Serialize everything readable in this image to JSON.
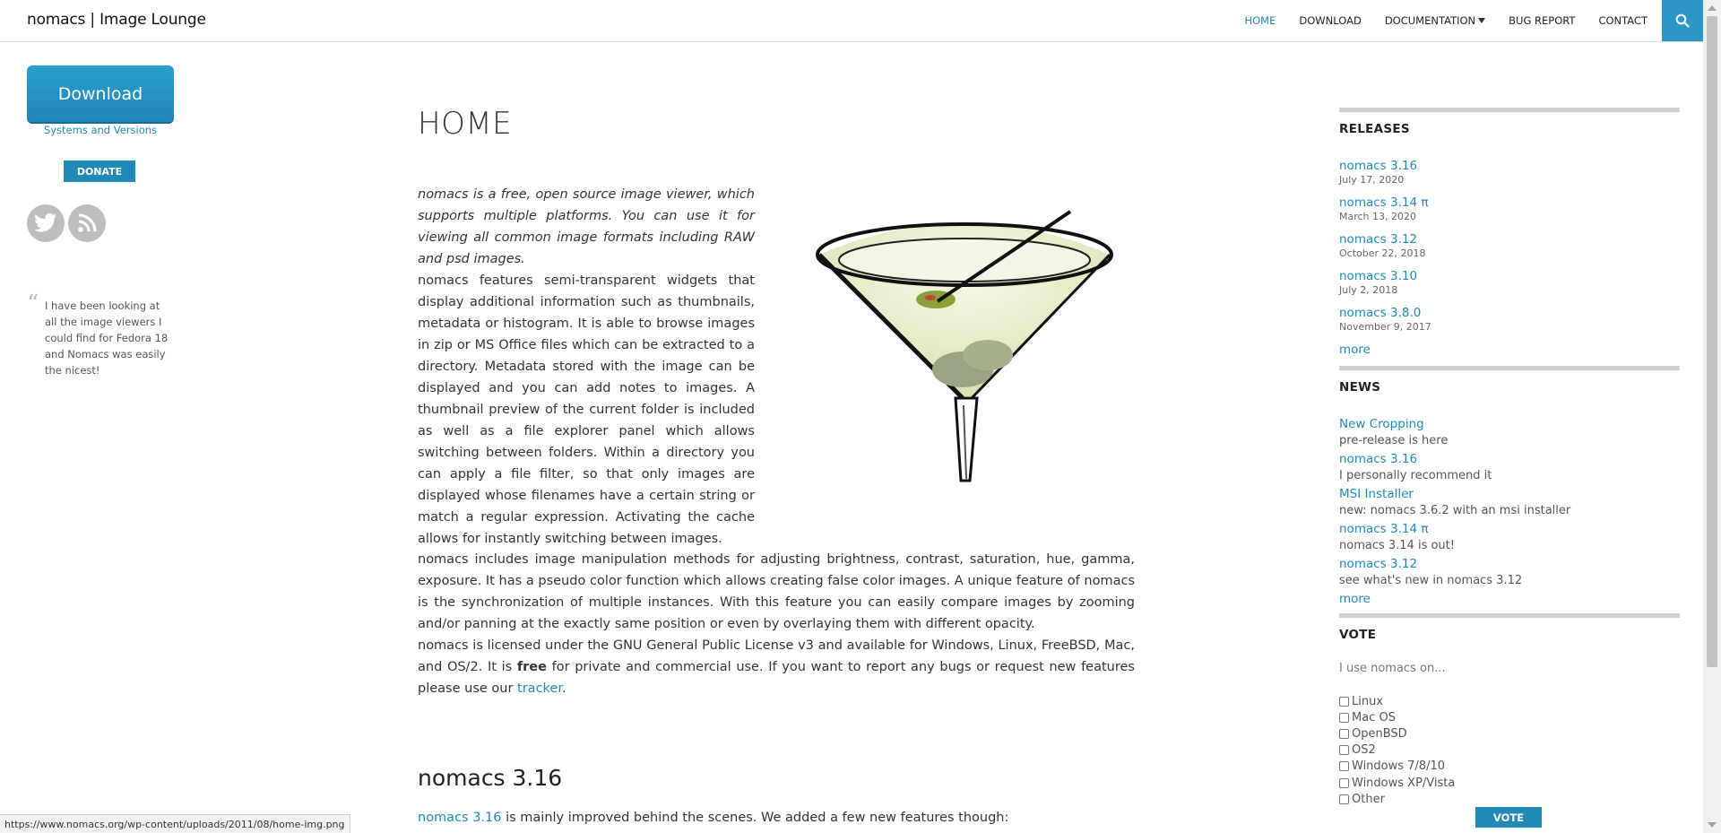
{
  "header": {
    "site_title": "nomacs | Image Lounge",
    "nav": [
      "HOME",
      "DOWNLOAD",
      "DOCUMENTATION",
      "BUG REPORT",
      "CONTACT"
    ]
  },
  "left": {
    "download_label": "Download",
    "systems_label": "Systems and Versions",
    "donate_label": "DONATE",
    "quote": "I have been looking at all the image viewers I could find for Fedora 18 and Nomacs was easily the nicest!"
  },
  "main": {
    "title": "HOME",
    "intro": "nomacs is a free, open source image viewer, which supports multiple platforms. You can use it for viewing all common image formats including RAW and psd images.",
    "para2": "nomacs features semi-transparent widgets that display additional information such as thumbnails, metadata or histogram. It is able to browse images in zip or MS Office files which can be extracted to a directory. Metadata stored with the image can be displayed and you can add notes to images. A thumbnail preview of the current folder is included as well as a file explorer panel which allows switching between folders. Within a directory you can apply a file filter, so that only images are displayed whose filenames have a certain string or match a regular expression. Activating the cache allows for instantly switching between images.",
    "para3": "nomacs includes image manipulation methods for adjusting brightness, contrast, saturation, hue, gamma, exposure. It has a pseudo color function which allows creating false color images. A unique feature of nomacs is the synchronization of multiple instances. With this feature you can easily compare images by zooming and/or panning at the exactly same position or even by overlaying them with different opacity.",
    "para4_a": "nomacs is licensed under the GNU General Public License v3 and available for Windows, Linux, FreeBSD, Mac, and OS/2. It is ",
    "para4_bold": "free",
    "para4_b": " for private and commercial use. If you want to report any bugs or request new features please use our ",
    "para4_link": "tracker",
    "para4_end": ".",
    "section_title": "nomacs 3.16",
    "para5_link": "nomacs 3.16",
    "para5_text": " is mainly improved behind the scenes. We added a few new features though:"
  },
  "releases": {
    "title": "RELEASES",
    "items": [
      {
        "name": "nomacs 3.16",
        "date": "July 17, 2020"
      },
      {
        "name": "nomacs 3.14 π",
        "date": "March 13, 2020"
      },
      {
        "name": "nomacs 3.12",
        "date": "October 22, 2018"
      },
      {
        "name": "nomacs 3.10",
        "date": "July 2, 2018"
      },
      {
        "name": "nomacs 3.8.0",
        "date": "November 9, 2017"
      }
    ],
    "more": "more"
  },
  "news": {
    "title": "NEWS",
    "items": [
      {
        "title": "New Cropping",
        "desc": "pre-release is here"
      },
      {
        "title": "nomacs 3.16",
        "desc": "I personally recommend it"
      },
      {
        "title": "MSI Installer",
        "desc": "new: nomacs 3.6.2 with an msi installer"
      },
      {
        "title": "nomacs 3.14 π",
        "desc": "nomacs 3.14 is out!"
      },
      {
        "title": "nomacs 3.12",
        "desc": "see what's new in nomacs 3.12"
      }
    ],
    "more": "more"
  },
  "vote": {
    "title": "VOTE",
    "question": "I use nomacs on...",
    "options": [
      "Linux",
      "Mac OS",
      "OpenBSD",
      "OS2",
      "Windows 7/8/10",
      "Windows XP/Vista",
      "Other"
    ],
    "button": "VOTE"
  },
  "status_url": "https://www.nomacs.org/wp-content/uploads/2011/08/home-img.png",
  "colors": {
    "accent": "#2189b8",
    "search_bg": "#2b97c9"
  }
}
